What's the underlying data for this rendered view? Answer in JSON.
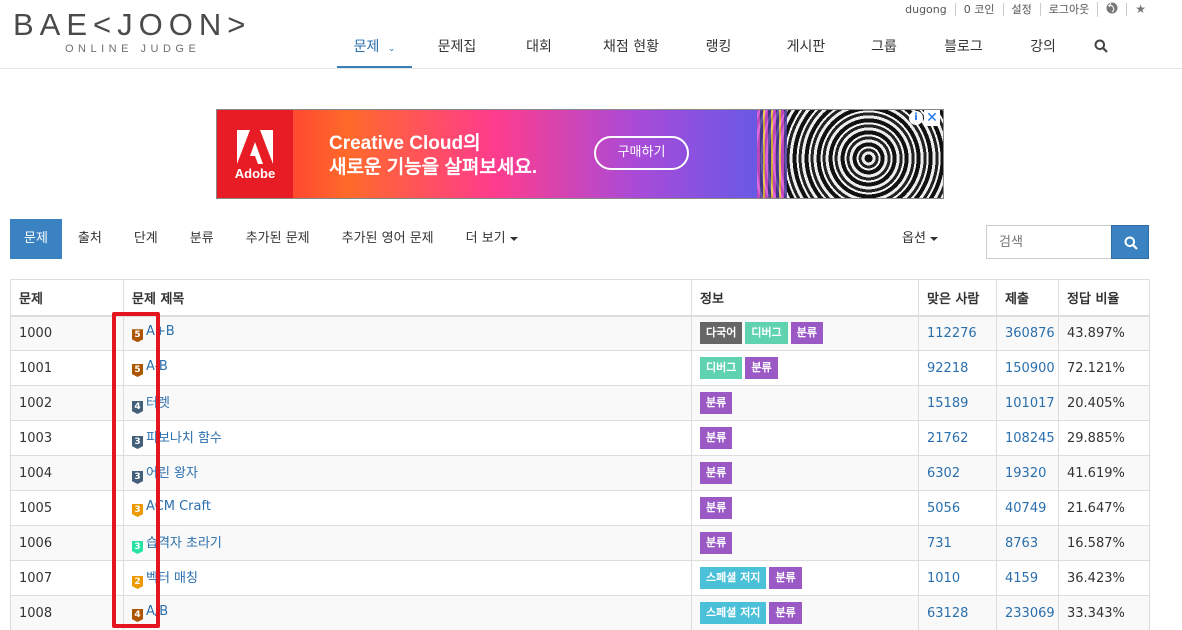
{
  "logo": {
    "main": "BAE<JOON>",
    "sub": "ONLINE JUDGE"
  },
  "userbar": {
    "items": [
      "dugong",
      "0 코인",
      "설정",
      "로그아웃"
    ],
    "icons": [
      "globe-icon",
      "star-icon"
    ]
  },
  "nav": {
    "items": [
      "문제",
      "문제집",
      "대회",
      "채점 현황",
      "랭킹",
      "게시판",
      "그룹",
      "블로그",
      "강의"
    ],
    "active_index": 0,
    "search_icon": "search-icon"
  },
  "ad": {
    "brand": "Adobe",
    "headline_1": "Creative Cloud의",
    "headline_2": "새로운 기능을 살펴보세요.",
    "cta": "구매하기",
    "info": "i",
    "close": "✕"
  },
  "subnav": {
    "items": [
      "문제",
      "출처",
      "단계",
      "분류",
      "추가된 문제",
      "추가된 영어 문제",
      "더 보기"
    ],
    "options": "옵션",
    "search_placeholder": "검색"
  },
  "table": {
    "headers": [
      "문제",
      "문제 제목",
      "정보",
      "맞은 사람",
      "제출",
      "정답 비율"
    ],
    "rows": [
      {
        "id": "1000",
        "tier": "5",
        "title": "A+B",
        "labels": [
          "다국어",
          "디버그",
          "분류"
        ],
        "solved": "112276",
        "submissions": "360876",
        "ratio": "43.897%"
      },
      {
        "id": "1001",
        "tier": "5",
        "title": "A-B",
        "labels": [
          "디버그",
          "분류"
        ],
        "solved": "92218",
        "submissions": "150900",
        "ratio": "72.121%"
      },
      {
        "id": "1002",
        "tier": "4",
        "title": "터렛",
        "labels": [
          "분류"
        ],
        "solved": "15189",
        "submissions": "101017",
        "ratio": "20.405%"
      },
      {
        "id": "1003",
        "tier": "3",
        "title": "피보나치 함수",
        "labels": [
          "분류"
        ],
        "solved": "21762",
        "submissions": "108245",
        "ratio": "29.885%"
      },
      {
        "id": "1004",
        "tier": "3",
        "title": "어린 왕자",
        "labels": [
          "분류"
        ],
        "solved": "6302",
        "submissions": "19320",
        "ratio": "41.619%"
      },
      {
        "id": "1005",
        "tier": "3",
        "title": "ACM Craft",
        "labels": [
          "분류"
        ],
        "solved": "5056",
        "submissions": "40749",
        "ratio": "21.647%"
      },
      {
        "id": "1006",
        "tier": "3",
        "title": "습격자 초라기",
        "labels": [
          "분류"
        ],
        "solved": "731",
        "submissions": "8763",
        "ratio": "16.587%"
      },
      {
        "id": "1007",
        "tier": "2",
        "title": "벡터 매칭",
        "labels": [
          "스페셜 저지",
          "분류"
        ],
        "solved": "1010",
        "submissions": "4159",
        "ratio": "36.423%"
      },
      {
        "id": "1008",
        "tier": "4",
        "title": "A/B",
        "labels": [
          "스페셜 저지",
          "분류"
        ],
        "solved": "63128",
        "submissions": "233069",
        "ratio": "33.343%"
      }
    ]
  },
  "colors": {
    "primary": "#3a82c1",
    "link": "#2a6fad",
    "label_multilang": "#666666",
    "label_debug": "#5fd3b0",
    "label_category": "#9b59c6",
    "label_special": "#4bc0d9",
    "tier_bronze": "#ad5600",
    "tier_silver": "#435f7a",
    "tier_gold": "#ec9a00",
    "tier_platinum": "#27e2a4",
    "highlight": "#e5151f"
  }
}
